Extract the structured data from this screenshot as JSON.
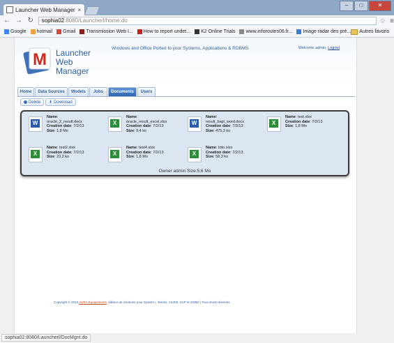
{
  "browser": {
    "tab_title": "Launcher Web Manager",
    "tab_close": "×",
    "url_host": "sophia02",
    "url_path": ":8080/Launcherl/home.do",
    "status_url": "sophia02:8080/Launcherl/DocMgnt.do",
    "window_controls": {
      "minimize": "–",
      "maximize": "□",
      "close": "✕"
    },
    "bookmarks": [
      {
        "label": "Google",
        "icon": "google-icon",
        "color": "#4285f4"
      },
      {
        "label": "hotmail",
        "icon": "windows-icon",
        "color": "#e8a33c"
      },
      {
        "label": "Gmail",
        "icon": "gmail-icon",
        "color": "#d44638"
      },
      {
        "label": "Transmission Web I...",
        "icon": "transmission-icon",
        "color": "#8a1c1c"
      },
      {
        "label": "How to report undet...",
        "icon": "k-icon",
        "color": "#c81e1e"
      },
      {
        "label": "K2 Online Trials",
        "icon": "k2-icon",
        "color": "#333333"
      },
      {
        "label": "www.inforoutes06.fr...",
        "icon": "page-icon",
        "color": "#888888"
      },
      {
        "label": "Image radar des pré...",
        "icon": "cloud-icon",
        "color": "#3c7bd8"
      }
    ],
    "other_bookmarks": "Autres favoris"
  },
  "header": {
    "logo_letter": "M",
    "app_name_line1": "Launcher",
    "app_name_line2": "Web",
    "app_name_line3": "Manager",
    "tagline": "Windows and Office Ported to your Systems, Applications & RDBMS",
    "welcome": "Welcome admin,",
    "logout": "Logout"
  },
  "nav": [
    {
      "label": "Home"
    },
    {
      "label": "Data Sources"
    },
    {
      "label": "Models"
    },
    {
      "label": "Jobs"
    },
    {
      "label": "Documents"
    },
    {
      "label": "Users"
    }
  ],
  "actions": {
    "delete": "Delete",
    "download": "Download"
  },
  "labels": {
    "name": "Name",
    "creation_date": "Creation date",
    "size": "Size"
  },
  "documents": [
    {
      "type": "word",
      "name": "oracle_2_result.docx",
      "date": "7/2/13",
      "size": "1,8 Mo"
    },
    {
      "type": "excel",
      "name": "oracle_result_excel.xlsx",
      "date": "7/2/13",
      "size": "9,4 ko"
    },
    {
      "type": "word",
      "name": "result_bapi_word.docx",
      "date": "7/2/13",
      "size": "475,3 ko"
    },
    {
      "type": "excel",
      "name": "test.xlsx",
      "date": "7/2/13",
      "size": "1,8 Mo"
    },
    {
      "type": "excel",
      "name": "test2.xlsx",
      "date": "7/2/13",
      "size": "23,2 ko"
    },
    {
      "type": "excel",
      "name": "test4.xlsx",
      "date": "7/2/13",
      "size": "1,8 Mo"
    },
    {
      "type": "excel",
      "name": "toto.xlsx",
      "date": "7/2/13",
      "size": "58,3 ko"
    }
  ],
  "owner_summary": "Owner admin Size:5,6 Mo",
  "footer": {
    "prefix": "Copyright © 2013",
    "company": "AURA Equipements",
    "suffix": ", éditeur de solutions pour System i, iSeries, AS400, SAP et SGBD | Tous droits réservés"
  }
}
